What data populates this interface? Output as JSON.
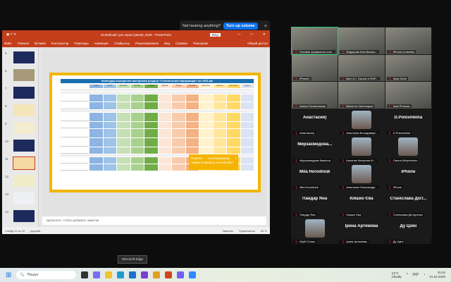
{
  "toast": {
    "text": "Not hearing anything?",
    "button": "Turn up volume",
    "close": "×"
  },
  "ppt": {
    "title": "04.Вебсайт для користувачів_2025 - PowerPoint",
    "badge": "Вхід",
    "menu": [
      "Файл",
      "Главная",
      "Вставка",
      "Конструктор",
      "Переходы",
      "Анимация",
      "Слайд-шоу",
      "Рецензирование",
      "Вид",
      "Справка",
      "Помощник"
    ],
    "share": "Общий доступ",
    "thumbnails": [
      {
        "n": "5",
        "c": "#1d2a5c"
      },
      {
        "n": "6",
        "c": "#a69a7a"
      },
      {
        "n": "7",
        "c": "#1d2a5c"
      },
      {
        "n": "8",
        "c": "#f4e6b8"
      },
      {
        "n": "9",
        "c": "#f4ecd0"
      },
      {
        "n": "10",
        "c": "#1d2a5c"
      },
      {
        "n": "11",
        "c": "#f4d9a0"
      },
      {
        "n": "12",
        "c": "#f1ecc8"
      },
      {
        "n": "13",
        "c": "#eef0f4"
      },
      {
        "n": "14",
        "c": "#1d2a5c"
      }
    ],
    "slide": {
      "title": "Календар поширення матеріалів розділу «Статистична інформація» на 2025 рік",
      "months": [
        "січень",
        "лютий",
        "березень",
        "квітень",
        "травень",
        "червень",
        "липень",
        "серпень",
        "вересень",
        "жовтень",
        "листопад",
        "грудень"
      ],
      "month_colors": [
        "#8db4e2",
        "#9dc3e6",
        "#c5e0b4",
        "#a9d18e",
        "#70ad47",
        "#fbe5d6",
        "#f8cbad",
        "#f4b183",
        "#fff2cc",
        "#ffe699",
        "#ffd966",
        "#dae3f3"
      ],
      "callout": "Перелік статінформації і термін її випуску на вебсайті"
    },
    "notes_placeholder": "Щелкните, чтобы добавить заметки",
    "status": {
      "slide": "Слайд 11 из 23",
      "lang": "русский",
      "notes": "Заметки",
      "comments": "Примечания",
      "zoom": "64 %"
    }
  },
  "gallery": [
    {
      "label": "Головне управління стат...",
      "video": true,
      "active": true
    },
    {
      "label": "Федорова Інна Валері...",
      "video": true
    },
    {
      "label": "iPhone (Ludmila)",
      "video": true
    },
    {
      "label": "iPhone7",
      "video": true
    },
    {
      "label": "Вісті А.І. Garant of ESP...",
      "video": true
    },
    {
      "label": "Ilona Derik",
      "video": true
    },
    {
      "label": "Анюта Потапчикова",
      "video": true
    },
    {
      "label": "Віолетта Світлицька",
      "video": true
    },
    {
      "label": "Inna Pronoza",
      "video": true
    },
    {
      "big": "Анастасия)",
      "label": "Анастасия)"
    },
    {
      "label": "Анастасія Володимирі...",
      "avatar": true
    },
    {
      "big": "D.Polovinkina",
      "label": "D.Polovinkina"
    },
    {
      "big": "Мирзахмедова...",
      "label": "Мирзахмедова Камілла"
    },
    {
      "label": "Калиняк Катерина М...",
      "avatar": true
    },
    {
      "label": "Ganna Motychenko",
      "avatar": true
    },
    {
      "big": "Mila Horodniuk",
      "label": "Mila Horodniuk"
    },
    {
      "label": "Анастасія Олександрі...",
      "avatar": true
    },
    {
      "big": "iPhone",
      "label": "iPhone"
    },
    {
      "big": "Пандар Яна",
      "label": "Пандар Яна"
    },
    {
      "big": "Кіяшко Єва",
      "label": "Кіяшко Єва"
    },
    {
      "big": "Станіслава Діхт...",
      "label": "Станіслава Діхтяренко"
    },
    {
      "label": "Юрій Сопко",
      "avatar": true
    },
    {
      "big": "Ірина Артемова",
      "label": "Ірина Артемова"
    },
    {
      "big": "Ду Цзіні",
      "label": "Ду Цзіні"
    }
  ],
  "tooltip": "Microsoft Edge",
  "taskbar": {
    "search": "Пошук",
    "temp": "14°C",
    "weather": "Cloudy",
    "lang": "УКР",
    "time": "15:34",
    "date": "01.04.2025",
    "apps": [
      {
        "name": "file-explorer-dark",
        "c": "#333"
      },
      {
        "name": "copilot",
        "c": "#7b6cf0"
      },
      {
        "name": "file-explorer",
        "c": "#f2c230"
      },
      {
        "name": "edge",
        "c": "#1f9bd1"
      },
      {
        "name": "store",
        "c": "#1a73c8"
      },
      {
        "name": "app-purple",
        "c": "#7a3fd0"
      },
      {
        "name": "chrome",
        "c": "#e0a020"
      },
      {
        "name": "powerpoint",
        "c": "#d04420"
      },
      {
        "name": "viber",
        "c": "#7360f2"
      },
      {
        "name": "zoom",
        "c": "#2d8cff"
      }
    ]
  }
}
